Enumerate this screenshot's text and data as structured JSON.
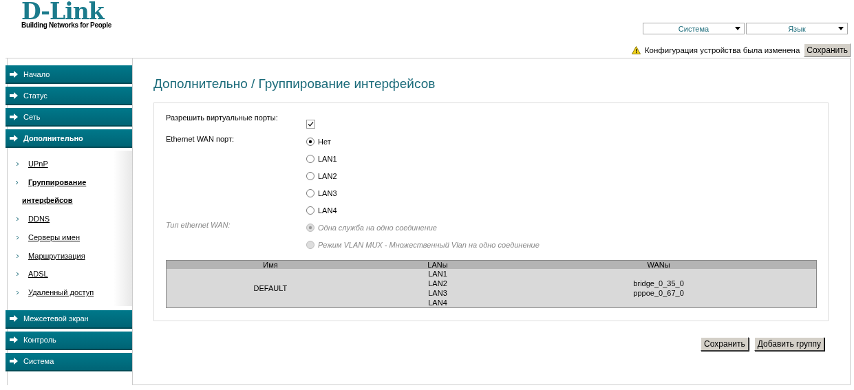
{
  "header": {
    "logo": "D-Link",
    "tagline": "Building Networks for People",
    "menus": [
      {
        "label": "Система"
      },
      {
        "label": "Язык"
      }
    ],
    "notice": "Конфигурация устройства была изменена",
    "notice_button": "Сохранить"
  },
  "sidebar": {
    "items": [
      {
        "label": "Начало",
        "expanded": false
      },
      {
        "label": "Статус",
        "expanded": false
      },
      {
        "label": "Сеть",
        "expanded": false
      },
      {
        "label": "Дополнительно",
        "expanded": true,
        "children": [
          {
            "label": "UPnP",
            "selected": false
          },
          {
            "label": "Группирование интерфейсов",
            "selected": true
          },
          {
            "label": "DDNS",
            "selected": false
          },
          {
            "label": "Серверы имен",
            "selected": false
          },
          {
            "label": "Маршрутизация",
            "selected": false
          },
          {
            "label": "ADSL",
            "selected": false
          },
          {
            "label": "Удаленный доступ",
            "selected": false
          }
        ]
      },
      {
        "label": "Межсетевой экран",
        "expanded": false
      },
      {
        "label": "Контроль",
        "expanded": false
      },
      {
        "label": "Система",
        "expanded": false
      }
    ]
  },
  "page": {
    "title": "Дополнительно / Группирование интерфейсов",
    "fields": [
      {
        "kind": "checkbox",
        "label": "Разрешить виртуальные порты:",
        "checked": true,
        "disabled": false
      },
      {
        "kind": "radio",
        "label": "Ethernet WAN порт:",
        "disabled": false,
        "options": [
          {
            "label": "Нет",
            "selected": true
          },
          {
            "label": "LAN1",
            "selected": false
          },
          {
            "label": "LAN2",
            "selected": false
          },
          {
            "label": "LAN3",
            "selected": false
          },
          {
            "label": "LAN4",
            "selected": false
          }
        ]
      },
      {
        "kind": "radio",
        "label": "Тип ethernet WAN:",
        "disabled": true,
        "options": [
          {
            "label": "Одна служба на одно соединение",
            "selected": true
          },
          {
            "label": "Режим VLAN MUX - Множественный Vlan на одно соединение",
            "selected": false
          }
        ]
      }
    ],
    "table": {
      "columns": [
        "Имя",
        "LANы",
        "WANы"
      ],
      "rows": [
        {
          "cells": [
            [
              "DEFAULT"
            ],
            [
              "LAN1",
              "LAN2",
              "LAN3",
              "LAN4"
            ],
            [
              "bridge_0_35_0",
              "pppoe_0_67_0"
            ]
          ]
        }
      ]
    },
    "buttons": [
      "Сохранить",
      "Добавить группу"
    ]
  }
}
